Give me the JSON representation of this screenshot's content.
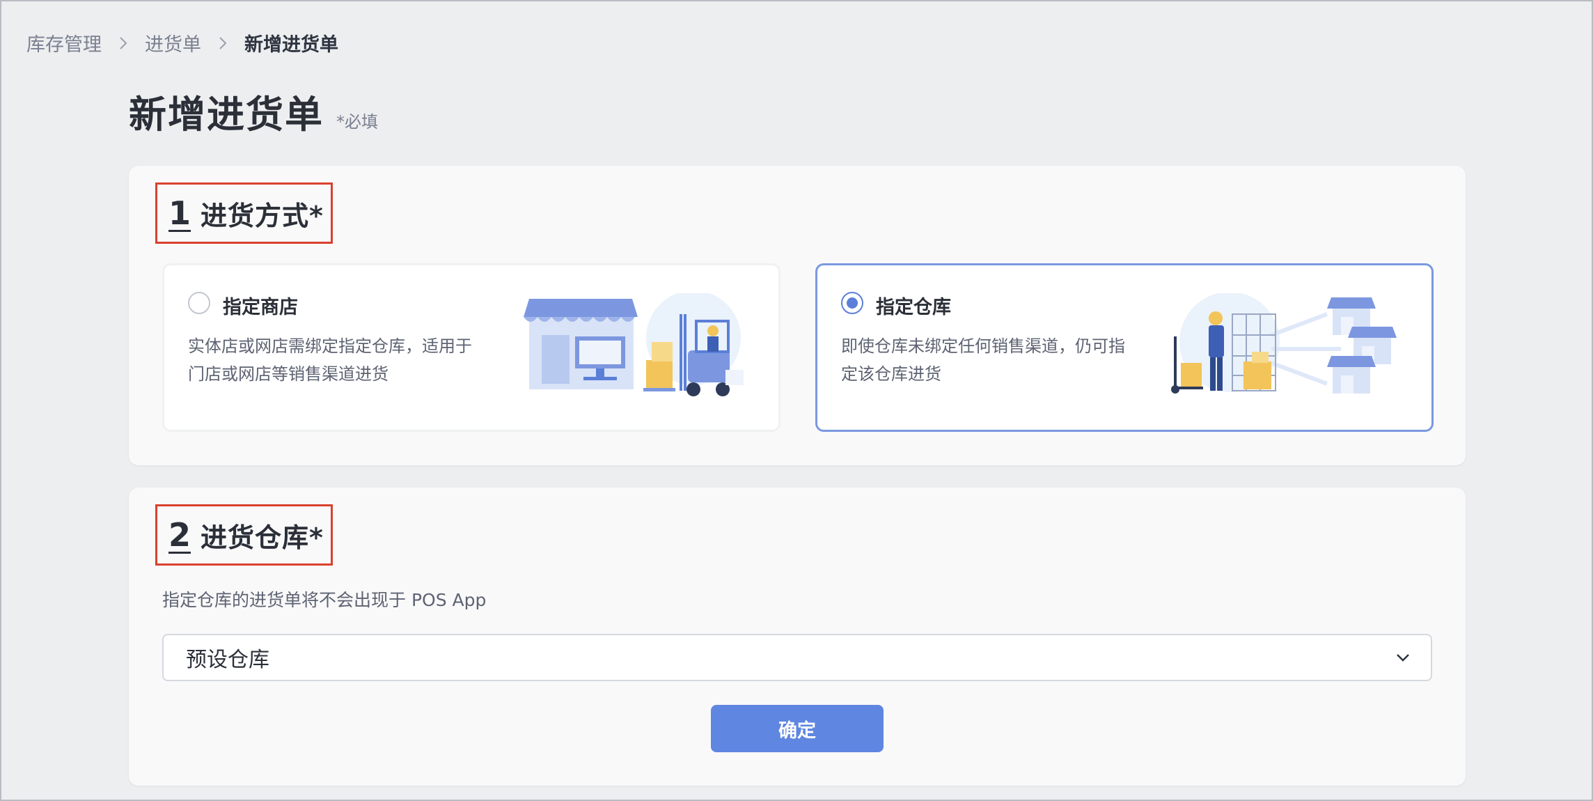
{
  "breadcrumb": {
    "items": [
      "库存管理",
      "进货单"
    ],
    "current": "新增进货单"
  },
  "page": {
    "title": "新增进货单",
    "required_note": "*必填"
  },
  "section1": {
    "number": "1",
    "title": "进货方式*",
    "options": [
      {
        "label": "指定商店",
        "description": "实体店或网店需绑定指定仓库，适用于门店或网店等销售渠道进货",
        "selected": false,
        "illustration": "store-forklift-illustration"
      },
      {
        "label": "指定仓库",
        "description": "即使仓库未绑定任何销售渠道，仍可指定该仓库进货",
        "selected": true,
        "illustration": "warehouse-stores-illustration"
      }
    ]
  },
  "section2": {
    "number": "2",
    "title": "进货仓库*",
    "hint": "指定仓库的进货单将不会出现于 POS App",
    "select_value": "预设仓库",
    "confirm_label": "确定"
  },
  "colors": {
    "accent": "#5f86e0",
    "radio_selected": "#5b7fd8",
    "highlight_border": "#d9412e",
    "background": "#edeef0"
  }
}
